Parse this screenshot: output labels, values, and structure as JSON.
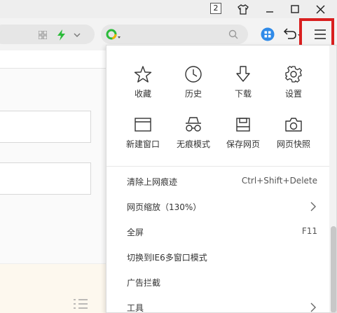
{
  "window": {
    "tab_count_badge": "2"
  },
  "menu": {
    "grid": [
      {
        "label": "收藏",
        "icon": "star-icon"
      },
      {
        "label": "历史",
        "icon": "clock-icon"
      },
      {
        "label": "下载",
        "icon": "download-arrow-icon"
      },
      {
        "label": "设置",
        "icon": "gear-icon"
      },
      {
        "label": "新建窗口",
        "icon": "new-window-icon"
      },
      {
        "label": "无痕模式",
        "icon": "incognito-icon"
      },
      {
        "label": "保存网页",
        "icon": "save-icon"
      },
      {
        "label": "网页快照",
        "icon": "camera-icon"
      }
    ],
    "rows": [
      {
        "label": "清除上网痕迹",
        "shortcut": "Ctrl+Shift+Delete"
      },
      {
        "label": "网页缩放（130%）",
        "shortcut": ""
      },
      {
        "label": "全屏",
        "shortcut": "F11"
      },
      {
        "label": "切换到IE6多窗口模式",
        "shortcut": ""
      },
      {
        "label": "广告拦截",
        "shortcut": ""
      },
      {
        "label": "工具",
        "shortcut": ""
      }
    ]
  },
  "colors": {
    "highlight": "#d91f1f",
    "accent_green": "#2bbb3a",
    "accent_blue": "#2f8ae8"
  }
}
